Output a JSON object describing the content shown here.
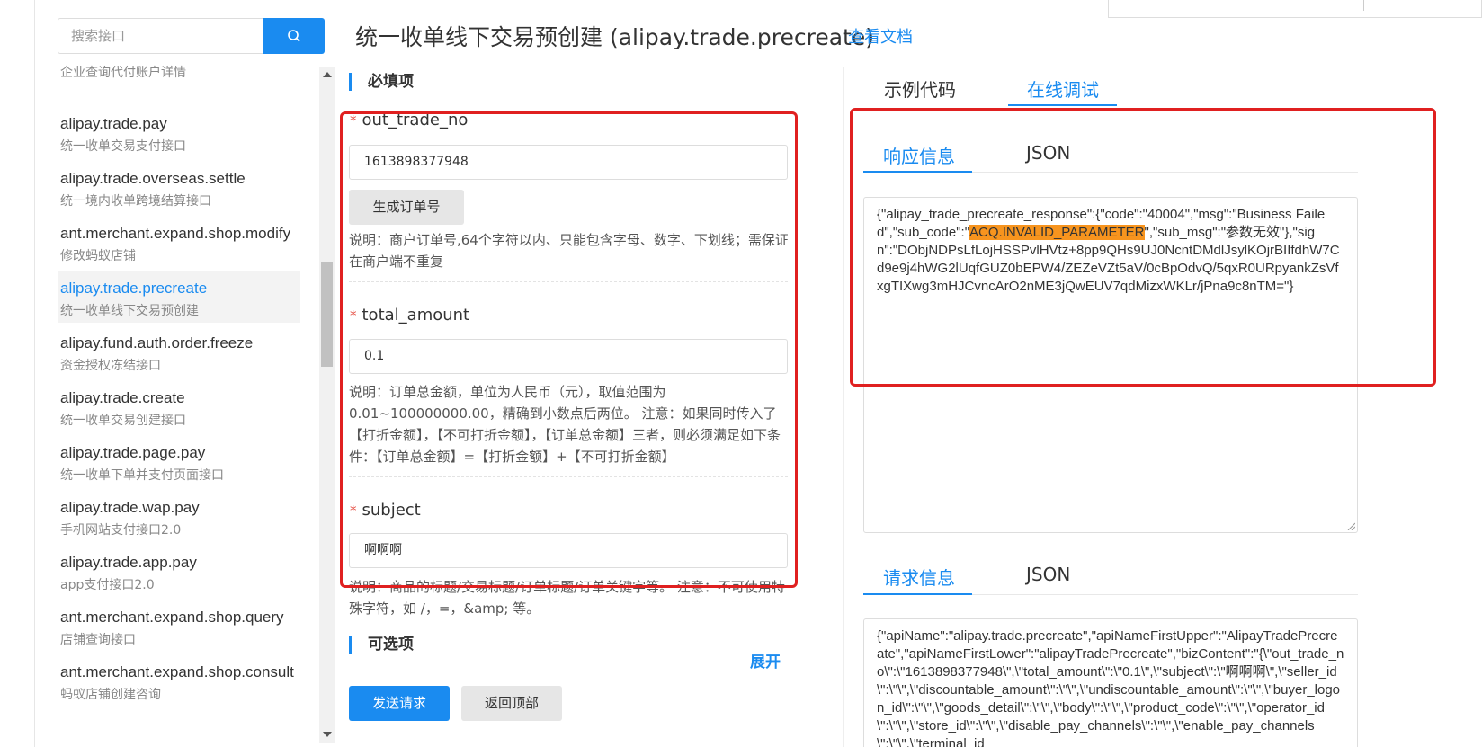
{
  "search": {
    "placeholder": "搜索接口",
    "button_icon": "search-icon"
  },
  "sidebar": {
    "items": [
      {
        "name": "",
        "desc": "企业查询代付账户详情",
        "partial": true
      },
      {
        "name": "alipay.trade.pay",
        "desc": "统一收单交易支付接口"
      },
      {
        "name": "alipay.trade.overseas.settle",
        "desc": "统一境内收单跨境结算接口"
      },
      {
        "name": "ant.merchant.expand.shop.modify",
        "desc": "修改蚂蚁店铺"
      },
      {
        "name": "alipay.trade.precreate",
        "desc": "统一收单线下交易预创建",
        "active": true
      },
      {
        "name": "alipay.fund.auth.order.freeze",
        "desc": "资金授权冻结接口"
      },
      {
        "name": "alipay.trade.create",
        "desc": "统一收单交易创建接口"
      },
      {
        "name": "alipay.trade.page.pay",
        "desc": "统一收单下单并支付页面接口"
      },
      {
        "name": "alipay.trade.wap.pay",
        "desc": "手机网站支付接口2.0"
      },
      {
        "name": "alipay.trade.app.pay",
        "desc": "app支付接口2.0"
      },
      {
        "name": "ant.merchant.expand.shop.query",
        "desc": "店铺查询接口"
      },
      {
        "name": "ant.merchant.expand.shop.consult",
        "desc": "蚂蚁店铺创建咨询"
      }
    ]
  },
  "header": {
    "title": "统一收单线下交易预创建 (alipay.trade.precreate)",
    "doc_link": "查看文档"
  },
  "form": {
    "required_title": "必填项",
    "optional_title": "可选项",
    "expand_label": "展开",
    "required_mark": "*",
    "fields": [
      {
        "name": "out_trade_no",
        "value": "1613898377948",
        "desc": "说明：商户订单号,64个字符以内、只能包含字母、数字、下划线；需保证在商户端不重复"
      },
      {
        "name": "total_amount",
        "value": "0.1",
        "desc": "说明：订单总金额，单位为人民币（元），取值范围为0.01~100000000.00，精确到小数点后两位。 注意：如果同时传入了【打折金额】，【不可打折金额】，【订单总金额】三者，则必须满足如下条件：【订单总金额】=【打折金额】+【不可打折金额】"
      },
      {
        "name": "subject",
        "value": "啊啊啊",
        "desc": "说明：商品的标题/交易标题/订单标题/订单关键字等。 注意：不可使用特殊字符，如 /，=，&amp; 等。"
      }
    ],
    "gen_order_button": "生成订单号",
    "send_button": "发送请求",
    "back_top_button": "返回顶部"
  },
  "panel": {
    "tabs": [
      "示例代码",
      "在线调试"
    ],
    "active_tab": 1,
    "response": {
      "tabs": [
        "响应信息",
        "JSON"
      ],
      "text_before": "{\"alipay_trade_precreate_response\":{\"code\":\"40004\",\"msg\":\"Business Failed\",\"sub_code\":\"",
      "highlight": "ACQ.INVALID_PARAMETER",
      "text_after": "\",\"sub_msg\":\"参数无效\"},\"sign\":\"DObjNDPsLfLojHSSPvlHVtz+8pp9QHs9UJ0NcntDMdlJsylKOjrBIIfdhW7Cd9e9j4hWG2lUqfGUZ0bEPW4/ZEZeVZt5aV/0cBpOdvQ/5qxR0URpyankZsVfxgTIXwg3mHJCvncArO2nME3jQwEUV7qdMizxWKLr/jPna9c8nTM=\"}"
    },
    "request": {
      "tabs": [
        "请求信息",
        "JSON"
      ],
      "text": "{\"apiName\":\"alipay.trade.precreate\",\"apiNameFirstUpper\":\"AlipayTradePrecreate\",\"apiNameFirstLower\":\"alipayTradePrecreate\",\"bizContent\":\"{\\\"out_trade_no\\\":\\\"1613898377948\\\",\\\"total_amount\\\":\\\"0.1\\\",\\\"subject\\\":\\\"啊啊啊\\\",\\\"seller_id\\\":\\\"\\\",\\\"discountable_amount\\\":\\\"\\\",\\\"undiscountable_amount\\\":\\\"\\\",\\\"buyer_logon_id\\\":\\\"\\\",\\\"goods_detail\\\":\\\"\\\",\\\"body\\\":\\\"\\\",\\\"product_code\\\":\\\"\\\",\\\"operator_id\\\":\\\"\\\",\\\"store_id\\\":\\\"\\\",\\\"disable_pay_channels\\\":\\\"\\\",\\\"enable_pay_channels\\\":\\\"\\\",\\\"terminal_id"
    }
  },
  "colors": {
    "accent": "#1a8bf0",
    "highlight": "#f7941e",
    "annotation": "#e02020"
  }
}
